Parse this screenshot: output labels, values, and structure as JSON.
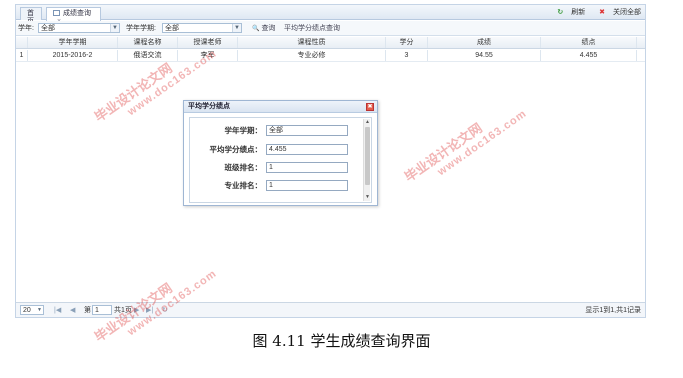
{
  "tabs": [
    {
      "label": "首页"
    },
    {
      "label": "成绩查询",
      "close": "×"
    }
  ],
  "tab_tools": {
    "refresh": "刷新",
    "close_all": "关闭全部",
    "refresh_icon": "↻",
    "close_all_icon": "✖"
  },
  "toolbar": {
    "year_label": "学年:",
    "year_value": "全部",
    "term_label": "学年学期:",
    "term_value": "全部",
    "search_icon": "🔍",
    "search_label": "查询",
    "gpa_label": "平均学分绩点查询"
  },
  "grid": {
    "columns": [
      "学年学期",
      "课程名称",
      "授课老师",
      "课程性质",
      "学分",
      "成绩",
      "绩点"
    ],
    "rows": [
      {
        "index": "1",
        "cells": [
          "2015-2016-2",
          "俄语交流",
          "李军",
          "专业必修",
          "3",
          "94.55",
          "4.455"
        ]
      }
    ]
  },
  "pager": {
    "page_size": "20",
    "page_prefix": "第",
    "page_value": "1",
    "page_suffix": "共1页",
    "summary": "显示1到1,共1记录"
  },
  "dialog": {
    "title": "平均学分绩点",
    "close": "✖",
    "fields": [
      {
        "label": "学年学期：",
        "value": "全部"
      },
      {
        "label": "平均学分绩点：",
        "value": "4.455"
      },
      {
        "label": "班级排名：",
        "value": "1"
      },
      {
        "label": "专业排名：",
        "value": "1"
      }
    ]
  },
  "caption": "图 4.11  学生成绩查询界面",
  "watermark": {
    "line1": "毕业设计论文网",
    "line2": "www.doc163.com"
  },
  "colors": {
    "accent": "#c5d4e6",
    "close_red": "#e45d4c",
    "watermark": "#dc3c3c"
  }
}
